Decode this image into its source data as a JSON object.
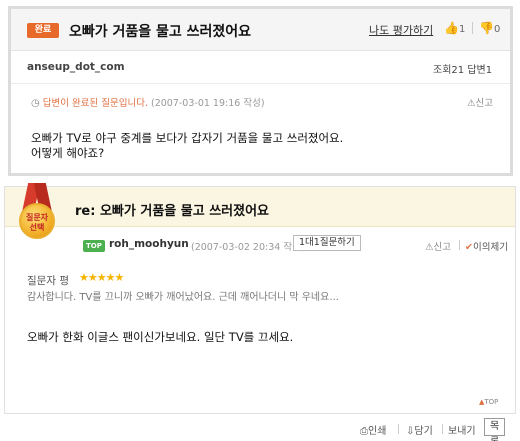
{
  "question": {
    "status_badge": "완료",
    "title": "오빠가 거품을 물고 쓰러졌어요",
    "rate_link": "나도 평가하기",
    "thumbs_up_count": "1",
    "thumbs_down_count": "0",
    "author": "anseup_dot_com",
    "views_label": "조회21",
    "answers_label": "답변1",
    "status_text_highlight": "답변이 완료된 질문입니다.",
    "status_text_date": "(2007-03-01 19:16 작성)",
    "report_label": "신고",
    "body_line1": "오빠가 TV로 야구 중계를 보다가 갑자기 거품을 물고 쓰러졌어요.",
    "body_line2": "어떻게 해야죠?"
  },
  "answer": {
    "title": "re: 오빠가 거품을 물고 쓰러졌어요",
    "medal_line1": "질문자",
    "medal_line2": "선택",
    "user_badge": "TOP",
    "user": "roh_moohyun",
    "date": "(2007-03-02 20:34 작성)",
    "qa_button": "1대1질문하기",
    "report_label": "신고",
    "objection_label": "이의제기",
    "eval_label": "질문자 평",
    "stars": "★★★★★",
    "eval_text": "감사합니다. TV를 끄니까 오빠가 깨어났어요. 근데 깨어나더니 막 우네요...",
    "body": "오빠가 한화 이글스 팬이신가보네요. 일단 TV를 끄세요.",
    "top_link": "TOP"
  },
  "toolbar": {
    "print": "인쇄",
    "save": "담기",
    "send": "보내기",
    "list": "목록"
  },
  "colors": {
    "badge_done": "#e86a2a",
    "answer_header_bg": "#fbf6e2",
    "star": "#f4b400",
    "top_badge": "#4caf50"
  },
  "icons": [
    "clock-icon",
    "thumbs-up-icon",
    "thumbs-down-icon",
    "report-icon",
    "medal-icon",
    "check-icon",
    "print-icon",
    "save-icon"
  ]
}
